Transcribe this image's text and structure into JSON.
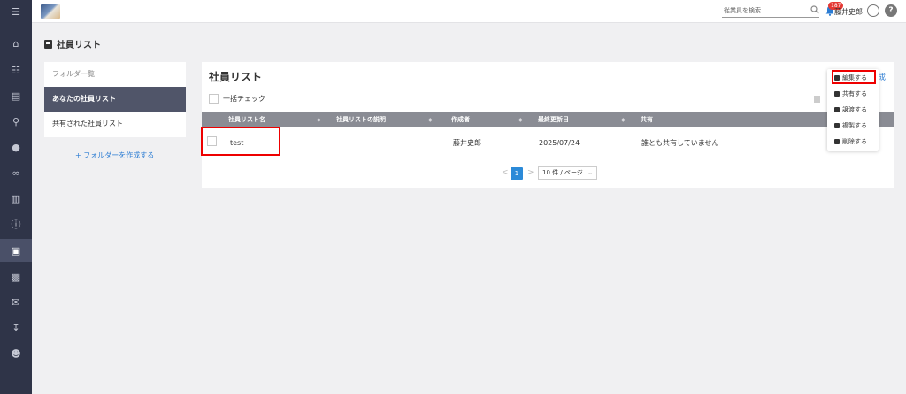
{
  "sidebar": {
    "icons": [
      "menu-icon",
      "home-icon",
      "org-chart-icon",
      "document-icon",
      "search-icon",
      "chat-icon",
      "link-icon",
      "chart-icon",
      "info-icon",
      "employee-list-icon",
      "book-icon",
      "mail-icon",
      "download-icon",
      "user-settings-icon"
    ],
    "active_index": 9
  },
  "topbar": {
    "search_placeholder": "従業員を検索",
    "notification_count": "187",
    "username": "藤井史郎",
    "help_label": "?"
  },
  "page": {
    "title": "社員リスト"
  },
  "folders": {
    "header": "フォルダ一覧",
    "items": [
      "あなたの社員リスト",
      "共有された社員リスト"
    ],
    "active_index": 0,
    "create_label": "+ フォルダーを作成する"
  },
  "main": {
    "title": "社員リスト",
    "partial_link": "成",
    "bulk_check_label": "一括チェック",
    "columns": [
      "社員リスト名",
      "社員リストの説明",
      "作成者",
      "最終更新日",
      "共有"
    ],
    "rows": [
      {
        "name": "test",
        "description": "",
        "creator": "藤井史郎",
        "updated": "2025/07/24",
        "shared": "誰とも共有していません"
      }
    ],
    "pagination": {
      "prev": "<",
      "current_page": "1",
      "next": ">",
      "page_size": "10 件 / ページ"
    }
  },
  "menu": {
    "items": [
      {
        "label": "編集する",
        "icon": "pencil-icon"
      },
      {
        "label": "共有する",
        "icon": "share-icon"
      },
      {
        "label": "譲渡する",
        "icon": "transfer-icon"
      },
      {
        "label": "複製する",
        "icon": "copy-icon"
      },
      {
        "label": "削除する",
        "icon": "trash-icon"
      }
    ]
  }
}
